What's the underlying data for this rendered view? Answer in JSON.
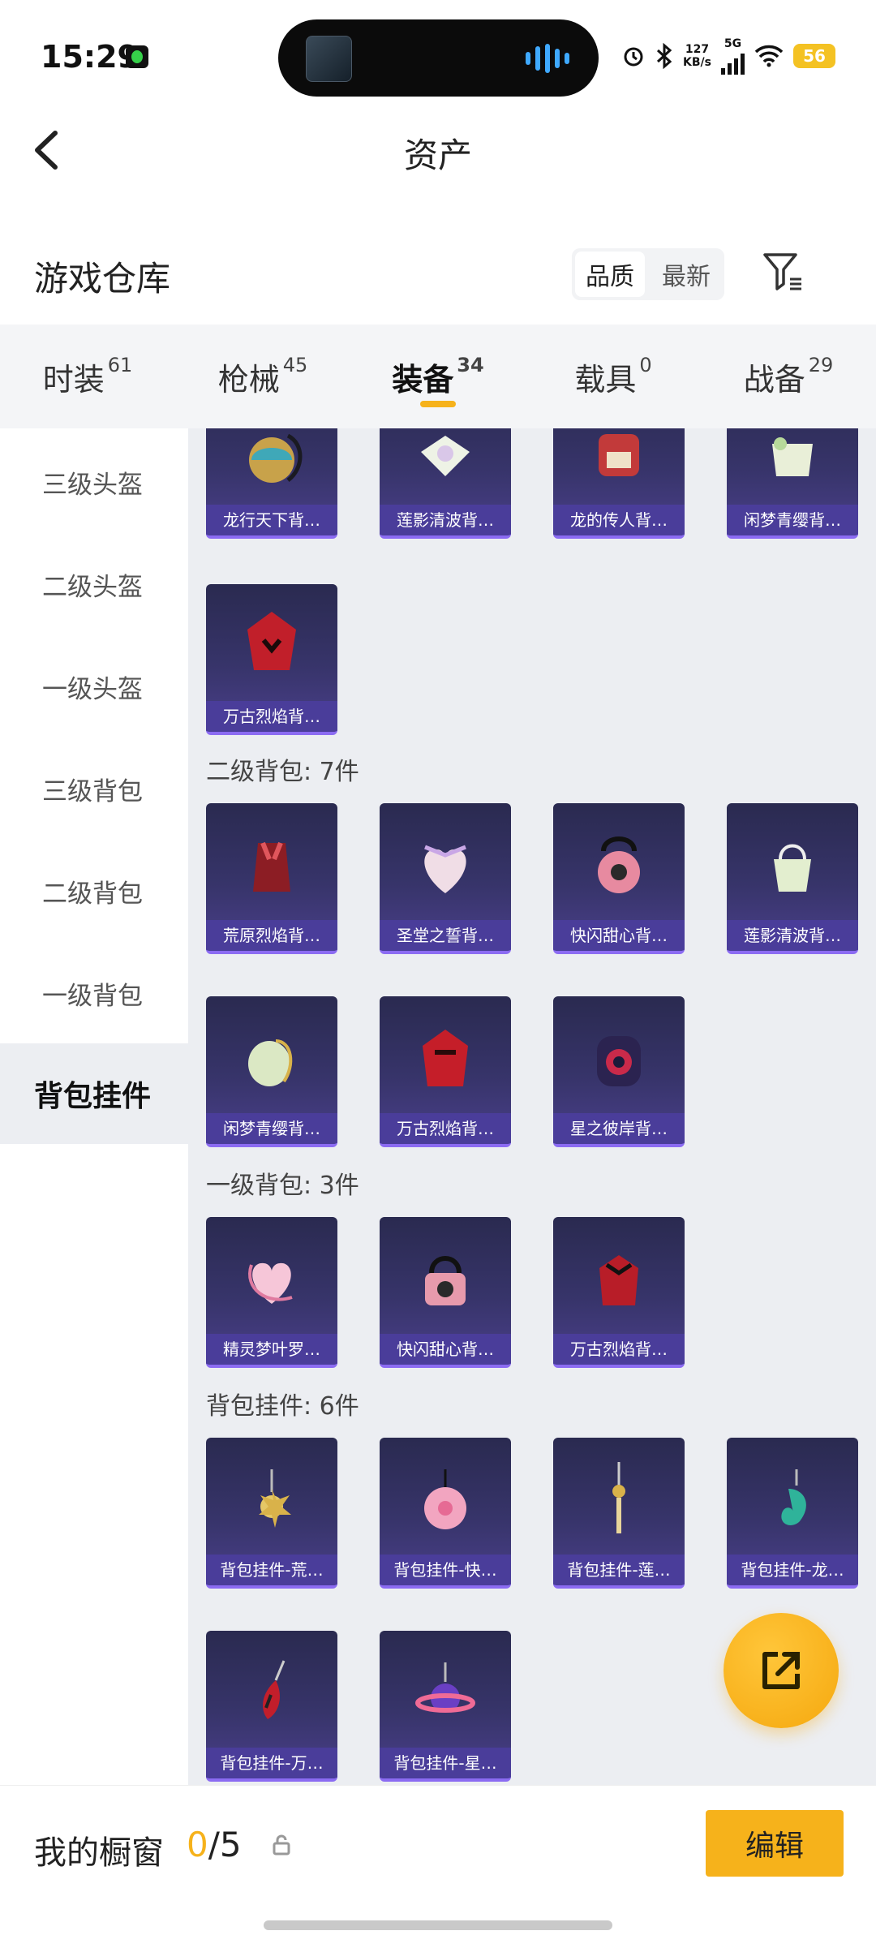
{
  "status": {
    "time": "15:29",
    "net_speed": "127",
    "net_unit": "KB/s",
    "net_type": "5G",
    "battery": "56"
  },
  "nav": {
    "title": "资产"
  },
  "warehouse": {
    "title": "游戏仓库",
    "sort": [
      "品质",
      "最新"
    ]
  },
  "tabs": [
    {
      "label": "时装",
      "count": "61"
    },
    {
      "label": "枪械",
      "count": "45"
    },
    {
      "label": "装备",
      "count": "34"
    },
    {
      "label": "载具",
      "count": "0"
    },
    {
      "label": "战备",
      "count": "29"
    }
  ],
  "sidebar": [
    "三级头盔",
    "二级头盔",
    "一级头盔",
    "三级背包",
    "二级背包",
    "一级背包",
    "背包挂件"
  ],
  "sections": {
    "top_partial": [
      "龙行天下背…",
      "莲影清波背…",
      "龙的传人背…",
      "闲梦青缨背…",
      "万古烈焰背…"
    ],
    "lvl2": {
      "title": "二级背包: 7件",
      "items": [
        "荒原烈焰背…",
        "圣堂之誓背…",
        "快闪甜心背…",
        "莲影清波背…",
        "闲梦青缨背…",
        "万古烈焰背…",
        "星之彼岸背…"
      ]
    },
    "lvl1": {
      "title": "一级背包: 3件",
      "items": [
        "精灵梦叶罗…",
        "快闪甜心背…",
        "万古烈焰背…"
      ]
    },
    "charms": {
      "title": "背包挂件: 6件",
      "items": [
        "背包挂件-荒…",
        "背包挂件-快…",
        "背包挂件-莲…",
        "背包挂件-龙…",
        "背包挂件-万…",
        "背包挂件-星…"
      ]
    }
  },
  "bottom": {
    "showcase_label": "我的橱窗",
    "current": "0",
    "max": "/5",
    "edit_label": "编辑"
  },
  "colors": {
    "accent": "#f6b21b",
    "card_bg": "#37346a",
    "card_label": "#4a3d9a"
  }
}
